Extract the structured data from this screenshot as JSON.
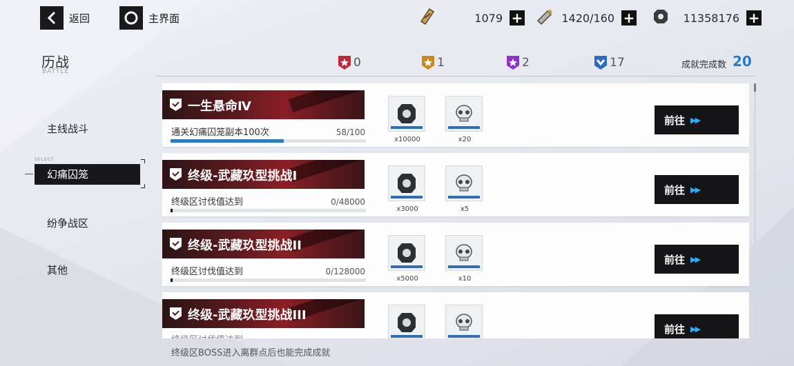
{
  "topbar": {
    "back_label": "返回",
    "home_label": "主界面",
    "resources": [
      {
        "icon": "ticket-icon",
        "value": "1079"
      },
      {
        "icon": "battery-icon",
        "value": "1420/160"
      },
      {
        "icon": "gear-coin-icon",
        "value": "11358176"
      }
    ]
  },
  "header": {
    "title": "历战",
    "subtitle": "BATTLE",
    "medals": [
      {
        "color": "#c0293a",
        "count": "0"
      },
      {
        "color": "#c88a1e",
        "count": "1"
      },
      {
        "color": "#8e33c4",
        "count": "2"
      },
      {
        "color": "#2b6cc0",
        "count": "17"
      }
    ],
    "achievement_label": "成就完成数",
    "achievement_value": "20"
  },
  "sidebar": {
    "select_tag": "SELECT",
    "items": [
      {
        "label": "主线战斗",
        "active": false
      },
      {
        "label": "幻痛囚笼",
        "active": true
      },
      {
        "label": "纷争战区",
        "active": false
      },
      {
        "label": "其他",
        "active": false
      }
    ]
  },
  "tasks": [
    {
      "title": "一生悬命Ⅳ",
      "desc": "通关幻痛囚笼副本100次",
      "progress": "58/100",
      "progress_fraction": 0.58,
      "rewards": [
        {
          "name": "gear-coin",
          "qty": "x10000"
        },
        {
          "name": "skull-chip",
          "qty": "x20"
        }
      ],
      "button": "前往"
    },
    {
      "title": "终级-武藏玖型挑战I",
      "desc": "终级区讨伐值达到",
      "progress": "0/48000",
      "progress_fraction": 0.0,
      "rewards": [
        {
          "name": "gear-coin",
          "qty": "x3000"
        },
        {
          "name": "skull-chip",
          "qty": "x5"
        }
      ],
      "button": "前往"
    },
    {
      "title": "终级-武藏玖型挑战II",
      "desc": "终级区讨伐值达到",
      "progress": "0/128000",
      "progress_fraction": 0.0,
      "rewards": [
        {
          "name": "gear-coin",
          "qty": "x5000"
        },
        {
          "name": "skull-chip",
          "qty": "x10"
        }
      ],
      "button": "前往"
    },
    {
      "title": "终级-武藏玖型挑战III",
      "desc": "终级区讨伐值达到",
      "progress": "",
      "progress_fraction": 0.0,
      "rewards": [
        {
          "name": "gear-coin",
          "qty": ""
        },
        {
          "name": "skull-chip",
          "qty": ""
        }
      ],
      "button": "前往"
    }
  ],
  "footer_note": "终级区BOSS进入离群点后也能完成成就"
}
